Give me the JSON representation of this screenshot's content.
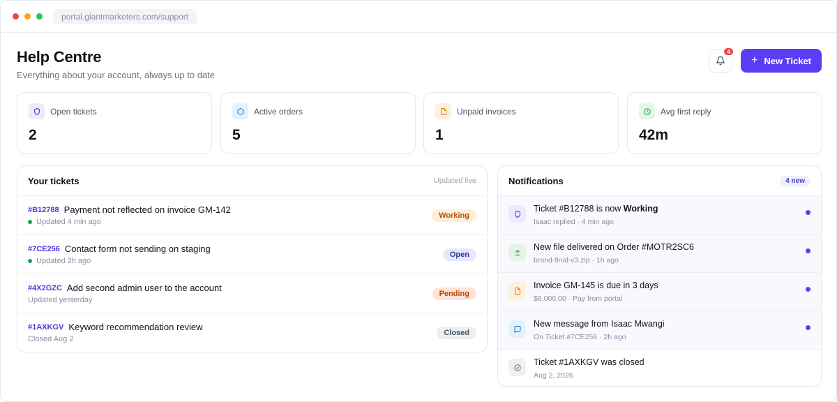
{
  "browser": {
    "url": "portal.giantmarketers.com/support"
  },
  "header": {
    "title": "Help Centre",
    "subtitle": "Everything about your account, always up to date",
    "notification_count": "4",
    "new_ticket_label": "New Ticket"
  },
  "stats": [
    {
      "label": "Open tickets",
      "value": "2",
      "icon": "shield-icon",
      "color": "#4c35d6",
      "bg": "#eceafd"
    },
    {
      "label": "Active orders",
      "value": "5",
      "icon": "box-icon",
      "color": "#0e7fb5",
      "bg": "#e2f2fb"
    },
    {
      "label": "Unpaid invoices",
      "value": "1",
      "icon": "document-icon",
      "color": "#d97706",
      "bg": "#fdf0dc"
    },
    {
      "label": "Avg first reply",
      "value": "42m",
      "icon": "clock-icon",
      "color": "#16a34a",
      "bg": "#e3f5e8"
    }
  ],
  "tickets_panel": {
    "title": "Your tickets",
    "status_text": "Updated live",
    "tickets": [
      {
        "id": "#B12788",
        "title": "Payment not reflected on invoice GM-142",
        "meta": "Updated 4 min ago",
        "live": true,
        "status": "Working",
        "status_color": "#b45309",
        "status_bg": "#fdefd5"
      },
      {
        "id": "#7CE256",
        "title": "Contact form not sending on staging",
        "meta": "Updated 2h ago",
        "live": true,
        "status": "Open",
        "status_color": "#3730a3",
        "status_bg": "#e6e8fb"
      },
      {
        "id": "#4X2GZC",
        "title": "Add second admin user to the account",
        "meta": "Updated yesterday",
        "live": false,
        "status": "Pending",
        "status_color": "#c2410c",
        "status_bg": "#fde4d7"
      },
      {
        "id": "#1AXKGV",
        "title": "Keyword recommendation review",
        "meta": "Closed Aug 2",
        "live": false,
        "status": "Closed",
        "status_color": "#4b5563",
        "status_bg": "#eceef1"
      }
    ]
  },
  "notifications_panel": {
    "title": "Notifications",
    "new_count": "4 new",
    "items": [
      {
        "title_prefix": "Ticket #B12788 is now ",
        "title_strong": "Working",
        "meta": "Isaac replied · 4 min ago",
        "icon": "shield-icon",
        "color": "#4c35d6",
        "bg": "#eceafd",
        "unread": true
      },
      {
        "title_prefix": "New file delivered on Order #MOTR2SC6",
        "title_strong": "",
        "meta": "brand-final-v3.zip · 1h ago",
        "icon": "upload-icon",
        "color": "#16a34a",
        "bg": "#e3f5e8",
        "unread": true
      },
      {
        "title_prefix": "Invoice GM-145 is due in 3 days",
        "title_strong": "",
        "meta": "$6,000.00 · Pay from portal",
        "icon": "document-icon",
        "color": "#d97706",
        "bg": "#fdf0dc",
        "unread": true
      },
      {
        "title_prefix": "New message from Isaac Mwangi",
        "title_strong": "",
        "meta": "On Ticket #7CE256 · 2h ago",
        "icon": "message-icon",
        "color": "#0e7fb5",
        "bg": "#e2f2fb",
        "unread": true
      },
      {
        "title_prefix": "Ticket #1AXKGV was closed",
        "title_strong": "",
        "meta": "Aug 2, 2026",
        "icon": "check-circle-icon",
        "color": "#6b7280",
        "bg": "#eef0f3",
        "unread": false
      }
    ]
  },
  "colors": {
    "accent": "#5b3df5",
    "badge": "#ef4444",
    "live": "#16a34a"
  }
}
